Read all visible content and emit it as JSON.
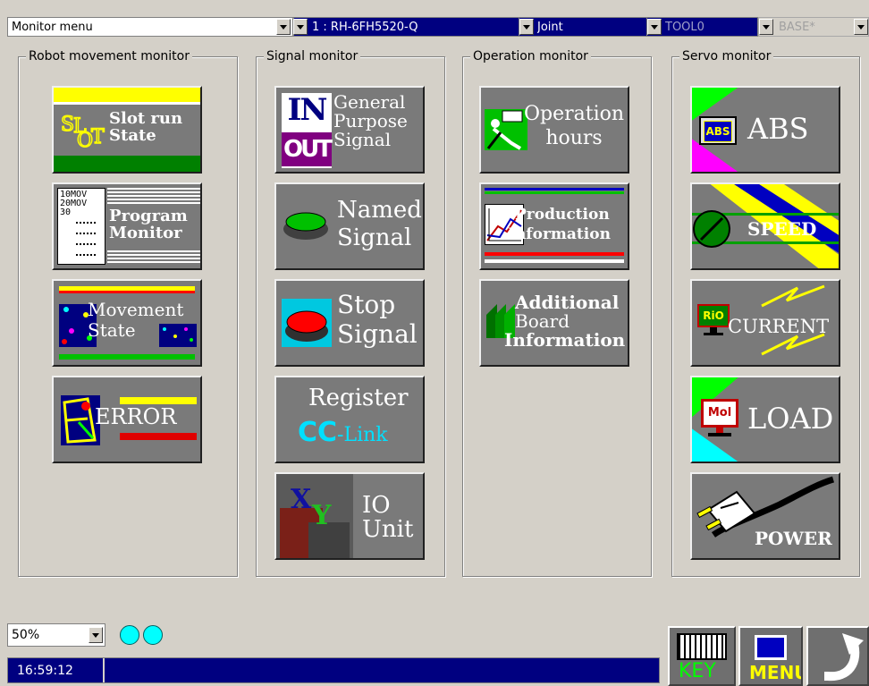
{
  "topbar": {
    "menu": "Monitor menu",
    "robot": "1 : RH-6FH5520-Q",
    "mode": "Joint",
    "tool": "TOOL0",
    "base": "BASE*"
  },
  "groups": {
    "robot_movement": {
      "title": "Robot movement monitor",
      "tiles": {
        "slot_run": [
          "Slot run",
          "State"
        ],
        "program": [
          "Program",
          "Monitor"
        ],
        "program_icon": [
          "10MOV",
          "20MOV",
          "30"
        ],
        "movement": [
          "Movement",
          "State"
        ],
        "error": "ERROR"
      }
    },
    "signal": {
      "title": "Signal monitor",
      "tiles": {
        "general": [
          "General",
          "Purpose",
          "Signal"
        ],
        "general_icon": [
          "IN",
          "OUT"
        ],
        "named": [
          "Named",
          "Signal"
        ],
        "stop": [
          "Stop",
          "Signal"
        ],
        "register": "Register",
        "cc_link": [
          "CC",
          "-Link"
        ],
        "io_unit": [
          "IO",
          "Unit"
        ],
        "io_icon": [
          "X",
          "Y"
        ]
      }
    },
    "operation": {
      "title": "Operation monitor",
      "tiles": {
        "hours": [
          "Operation",
          "hours"
        ],
        "production": [
          "Production",
          "Information"
        ],
        "additional": [
          "Additional",
          "Board",
          "Information"
        ]
      }
    },
    "servo": {
      "title": "Servo monitor",
      "tiles": {
        "abs": "ABS",
        "abs_icon": "ABS",
        "speed": "SPEED",
        "current": "CURRENT",
        "current_icon": "RiO",
        "load": "LOAD",
        "load_icon": "Mol",
        "power": "POWER"
      }
    }
  },
  "bottom": {
    "zoom": "50%",
    "time": "16:59:12",
    "key_label": "KEY",
    "menu_label": "MENU"
  },
  "colors": {
    "navy": "#000080",
    "tile_grey": "#7a7a7a",
    "window_bg": "#d4d0c8",
    "indicator": "#00ffff"
  }
}
